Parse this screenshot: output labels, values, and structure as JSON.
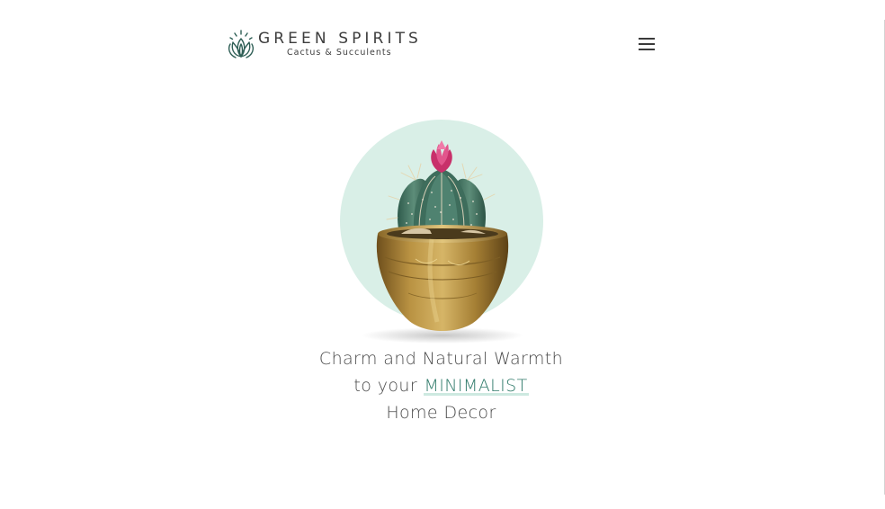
{
  "header": {
    "brand_name": "GREEN SPIRITS",
    "tagline": "Cactus & Succulents",
    "logo_icon": "lotus-logo-icon",
    "menu_icon": "hamburger-menu-icon"
  },
  "hero": {
    "image_icon": "cactus-in-brass-pot-illustration",
    "circle_color": "#d9efe7",
    "headline": {
      "line1": "Charm and Natural Warmth",
      "line2_prefix": "to your",
      "line2_highlight": "MINIMALIST",
      "line3": "Home Decor"
    }
  },
  "colors": {
    "accent": "#2f7a6a",
    "circle": "#d9efe7",
    "flower": "#d9417a",
    "pot": "#a88436"
  }
}
